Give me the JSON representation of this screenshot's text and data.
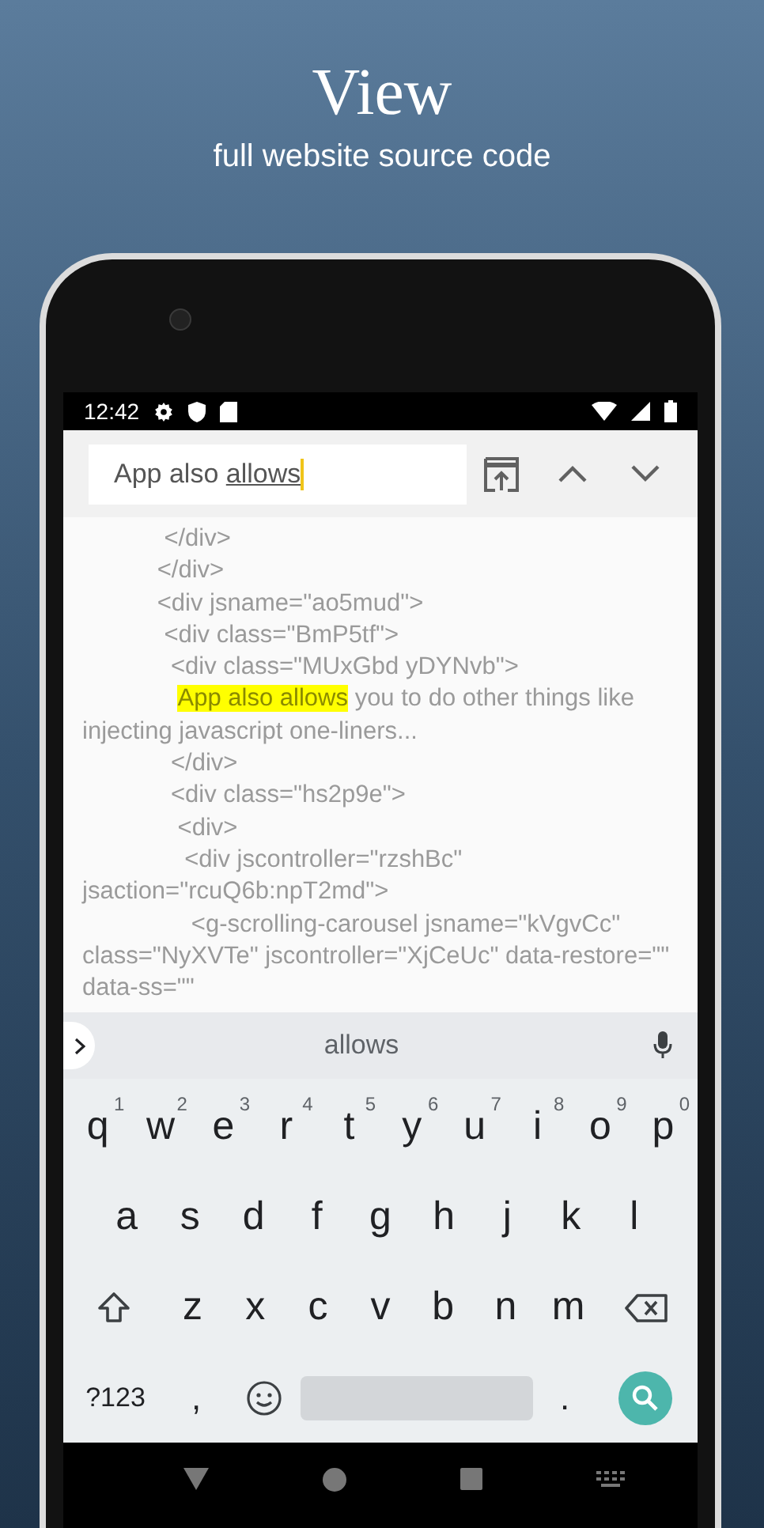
{
  "promo": {
    "title": "View",
    "subtitle": "full website source code"
  },
  "status_bar": {
    "time": "12:42"
  },
  "find_bar": {
    "query_parts": [
      {
        "text": "App also ",
        "composing": false
      },
      {
        "text": "allows",
        "composing": true
      }
    ]
  },
  "source_lines": [
    {
      "parts": [
        {
          "text": "            </div>",
          "highlighted": false
        }
      ]
    },
    {
      "parts": [
        {
          "text": "           </div>",
          "highlighted": false
        }
      ]
    },
    {
      "parts": [
        {
          "text": "           <div jsname=\"ao5mud\">",
          "highlighted": false
        }
      ]
    },
    {
      "parts": [
        {
          "text": "            <div class=\"BmP5tf\">",
          "highlighted": false
        }
      ]
    },
    {
      "parts": [
        {
          "text": "             <div class=\"MUxGbd yDYNvb\">",
          "highlighted": false
        }
      ]
    },
    {
      "parts": [
        {
          "text": "              App also allows",
          "highlighted": true
        },
        {
          "text": " you to do other things like injecting javascript one-liners...",
          "highlighted": false
        }
      ]
    },
    {
      "parts": [
        {
          "text": "             </div>",
          "highlighted": false
        }
      ]
    },
    {
      "parts": [
        {
          "text": "             <div class=\"hs2p9e\">",
          "highlighted": false
        }
      ]
    },
    {
      "parts": [
        {
          "text": "              <div>",
          "highlighted": false
        }
      ]
    },
    {
      "parts": [
        {
          "text": "               <div jscontroller=\"rzshBc\" jsaction=\"rcuQ6b:npT2md\">",
          "highlighted": false
        }
      ]
    },
    {
      "parts": [
        {
          "text": "                <g-scrolling-carousel jsname=\"kVgvCc\" class=\"NyXVTe\" jscontroller=\"XjCeUc\" data-restore=\"\" data-ss=\"\"",
          "highlighted": false
        }
      ]
    }
  ],
  "suggestion_bar": {
    "suggestion": "allows"
  },
  "keyboard": {
    "letter_rows": [
      [
        {
          "kind": "letter",
          "label": "q",
          "hint": "1"
        },
        {
          "kind": "letter",
          "label": "w",
          "hint": "2"
        },
        {
          "kind": "letter",
          "label": "e",
          "hint": "3"
        },
        {
          "kind": "letter",
          "label": "r",
          "hint": "4"
        },
        {
          "kind": "letter",
          "label": "t",
          "hint": "5"
        },
        {
          "kind": "letter",
          "label": "y",
          "hint": "6"
        },
        {
          "kind": "letter",
          "label": "u",
          "hint": "7"
        },
        {
          "kind": "letter",
          "label": "i",
          "hint": "8"
        },
        {
          "kind": "letter",
          "label": "o",
          "hint": "9"
        },
        {
          "kind": "letter",
          "label": "p",
          "hint": "0"
        }
      ],
      [
        {
          "kind": "letter",
          "label": "a"
        },
        {
          "kind": "letter",
          "label": "s"
        },
        {
          "kind": "letter",
          "label": "d"
        },
        {
          "kind": "letter",
          "label": "f"
        },
        {
          "kind": "letter",
          "label": "g"
        },
        {
          "kind": "letter",
          "label": "h"
        },
        {
          "kind": "letter",
          "label": "j"
        },
        {
          "kind": "letter",
          "label": "k"
        },
        {
          "kind": "letter",
          "label": "l"
        }
      ],
      [
        {
          "kind": "shift"
        },
        {
          "kind": "letter",
          "label": "z"
        },
        {
          "kind": "letter",
          "label": "x"
        },
        {
          "kind": "letter",
          "label": "c"
        },
        {
          "kind": "letter",
          "label": "v"
        },
        {
          "kind": "letter",
          "label": "b"
        },
        {
          "kind": "letter",
          "label": "n"
        },
        {
          "kind": "letter",
          "label": "m"
        },
        {
          "kind": "backspace"
        }
      ]
    ],
    "bottom_row": [
      {
        "kind": "symbols",
        "label": "?123"
      },
      {
        "kind": "punct",
        "label": ","
      },
      {
        "kind": "emoji"
      },
      {
        "kind": "space"
      },
      {
        "kind": "punct",
        "label": "."
      },
      {
        "kind": "search"
      }
    ]
  }
}
